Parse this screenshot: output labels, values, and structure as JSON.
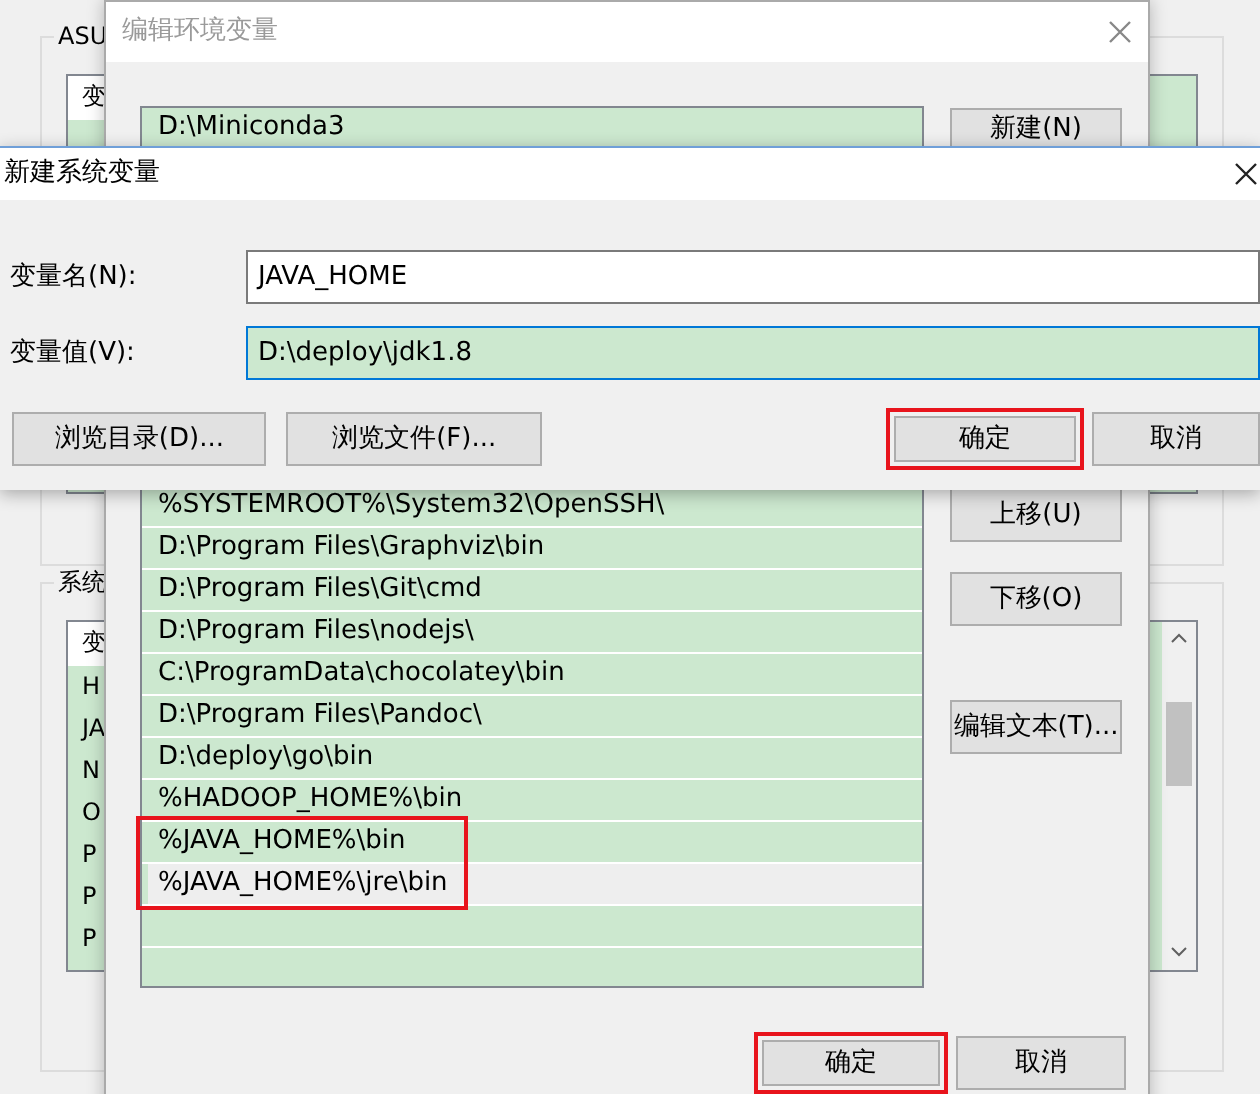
{
  "background_window": {
    "top_group": {
      "label": "ASU",
      "items": [
        {
          "text": "变",
          "kind": "header"
        }
      ]
    },
    "bottom_group": {
      "label": "系统",
      "items": [
        {
          "text": "变",
          "kind": "header"
        },
        {
          "text": "H",
          "kind": "row"
        },
        {
          "text": "JA",
          "kind": "row"
        },
        {
          "text": "N",
          "kind": "row"
        },
        {
          "text": "O",
          "kind": "row"
        },
        {
          "text": "P",
          "kind": "row"
        },
        {
          "text": "P",
          "kind": "row"
        },
        {
          "text": "P",
          "kind": "row"
        }
      ]
    }
  },
  "edit_dialog": {
    "title": "编辑环境变量",
    "paths": [
      {
        "text": "D:\\Miniconda3",
        "selected": false,
        "highlighted": false
      },
      {
        "text": "%SYSTEMROOT%\\System32\\OpenSSH\\",
        "selected": false,
        "highlighted": false
      },
      {
        "text": "D:\\Program Files\\Graphviz\\bin",
        "selected": false,
        "highlighted": false
      },
      {
        "text": "D:\\Program Files\\Git\\cmd",
        "selected": false,
        "highlighted": false
      },
      {
        "text": "D:\\Program Files\\nodejs\\",
        "selected": false,
        "highlighted": false
      },
      {
        "text": "C:\\ProgramData\\chocolatey\\bin",
        "selected": false,
        "highlighted": false
      },
      {
        "text": "D:\\Program Files\\Pandoc\\",
        "selected": false,
        "highlighted": false
      },
      {
        "text": "D:\\deploy\\go\\bin",
        "selected": false,
        "highlighted": false
      },
      {
        "text": "%HADOOP_HOME%\\bin",
        "selected": false,
        "highlighted": false
      },
      {
        "text": "%JAVA_HOME%\\bin",
        "selected": false,
        "highlighted": true
      },
      {
        "text": "%JAVA_HOME%\\jre\\bin",
        "selected": true,
        "highlighted": true
      }
    ],
    "side_buttons": [
      {
        "label": "新建(N)"
      },
      {
        "label": "上移(U)"
      },
      {
        "label": "下移(O)"
      },
      {
        "label": "编辑文本(T)..."
      }
    ],
    "footer_buttons": [
      {
        "label": "确定",
        "highlighted": true
      },
      {
        "label": "取消",
        "highlighted": false
      }
    ]
  },
  "new_variable_dialog": {
    "title": "新建系统变量",
    "fields": [
      {
        "label": "变量名(N):",
        "value": "JAVA_HOME",
        "focused": false
      },
      {
        "label": "变量值(V):",
        "value": "D:\\deploy\\jdk1.8",
        "focused": true
      }
    ],
    "buttons": [
      {
        "label": "浏览目录(D)...",
        "highlighted": false
      },
      {
        "label": "浏览文件(F)...",
        "highlighted": false
      },
      {
        "label": "确定",
        "highlighted": true
      },
      {
        "label": "取消",
        "highlighted": false
      }
    ]
  }
}
